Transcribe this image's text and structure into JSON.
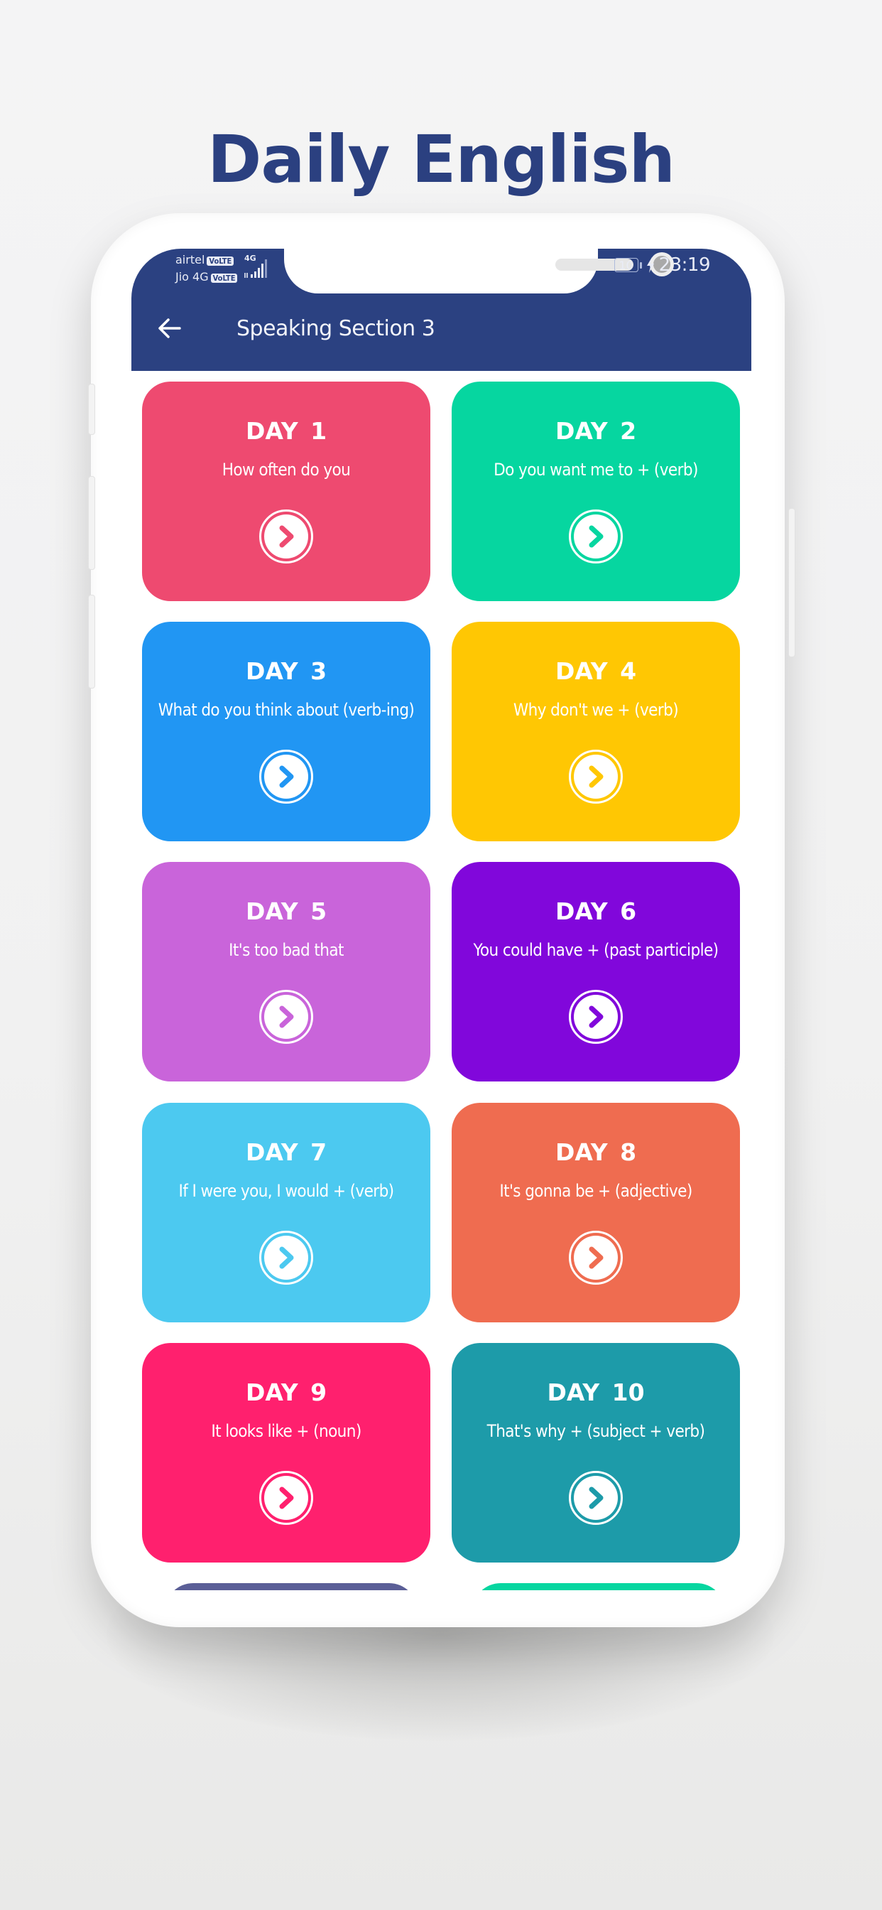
{
  "promo": {
    "title": "Daily English"
  },
  "status_bar": {
    "carrier_1": "airtel",
    "carrier_1_badge": "VoLTE",
    "carrier_2": "Jio 4G",
    "carrier_2_badge": "VoLTE",
    "network_type": "4G",
    "battery_level": "10",
    "time": "23:19"
  },
  "header": {
    "back_icon": "arrow-left-icon",
    "title": "Speaking Section 3",
    "background_color": "#2B4181"
  },
  "days": [
    {
      "label": "DAY  1",
      "phrase": "How often do you",
      "color": "#EE4A70"
    },
    {
      "label": "DAY  2",
      "phrase": "Do you want me to + (verb)",
      "color": "#06D6A0"
    },
    {
      "label": "DAY  3",
      "phrase": "What do you think about (verb-ing)",
      "color": "#2196F3"
    },
    {
      "label": "DAY  4",
      "phrase": "Why don't we + (verb)",
      "color": "#FFC703"
    },
    {
      "label": "DAY  5",
      "phrase": "It's too bad that",
      "color": "#C964DA"
    },
    {
      "label": "DAY  6",
      "phrase": "You could have + (past participle)",
      "color": "#8107DB"
    },
    {
      "label": "DAY  7",
      "phrase": "If I were you, I would + (verb)",
      "color": "#4CC9F0"
    },
    {
      "label": "DAY  8",
      "phrase": "It's gonna be + (adjective)",
      "color": "#EF6C50"
    },
    {
      "label": "DAY  9",
      "phrase": "It looks like + (noun)",
      "color": "#FF206E"
    },
    {
      "label": "DAY  10",
      "phrase": "That's why + (subject + verb)",
      "color": "#1D9BA9"
    }
  ],
  "partial_cards": [
    {
      "color": "#5B5F97"
    },
    {
      "color": "#06D6A0"
    }
  ],
  "card_action_icon": "chevron-right-circle-icon"
}
